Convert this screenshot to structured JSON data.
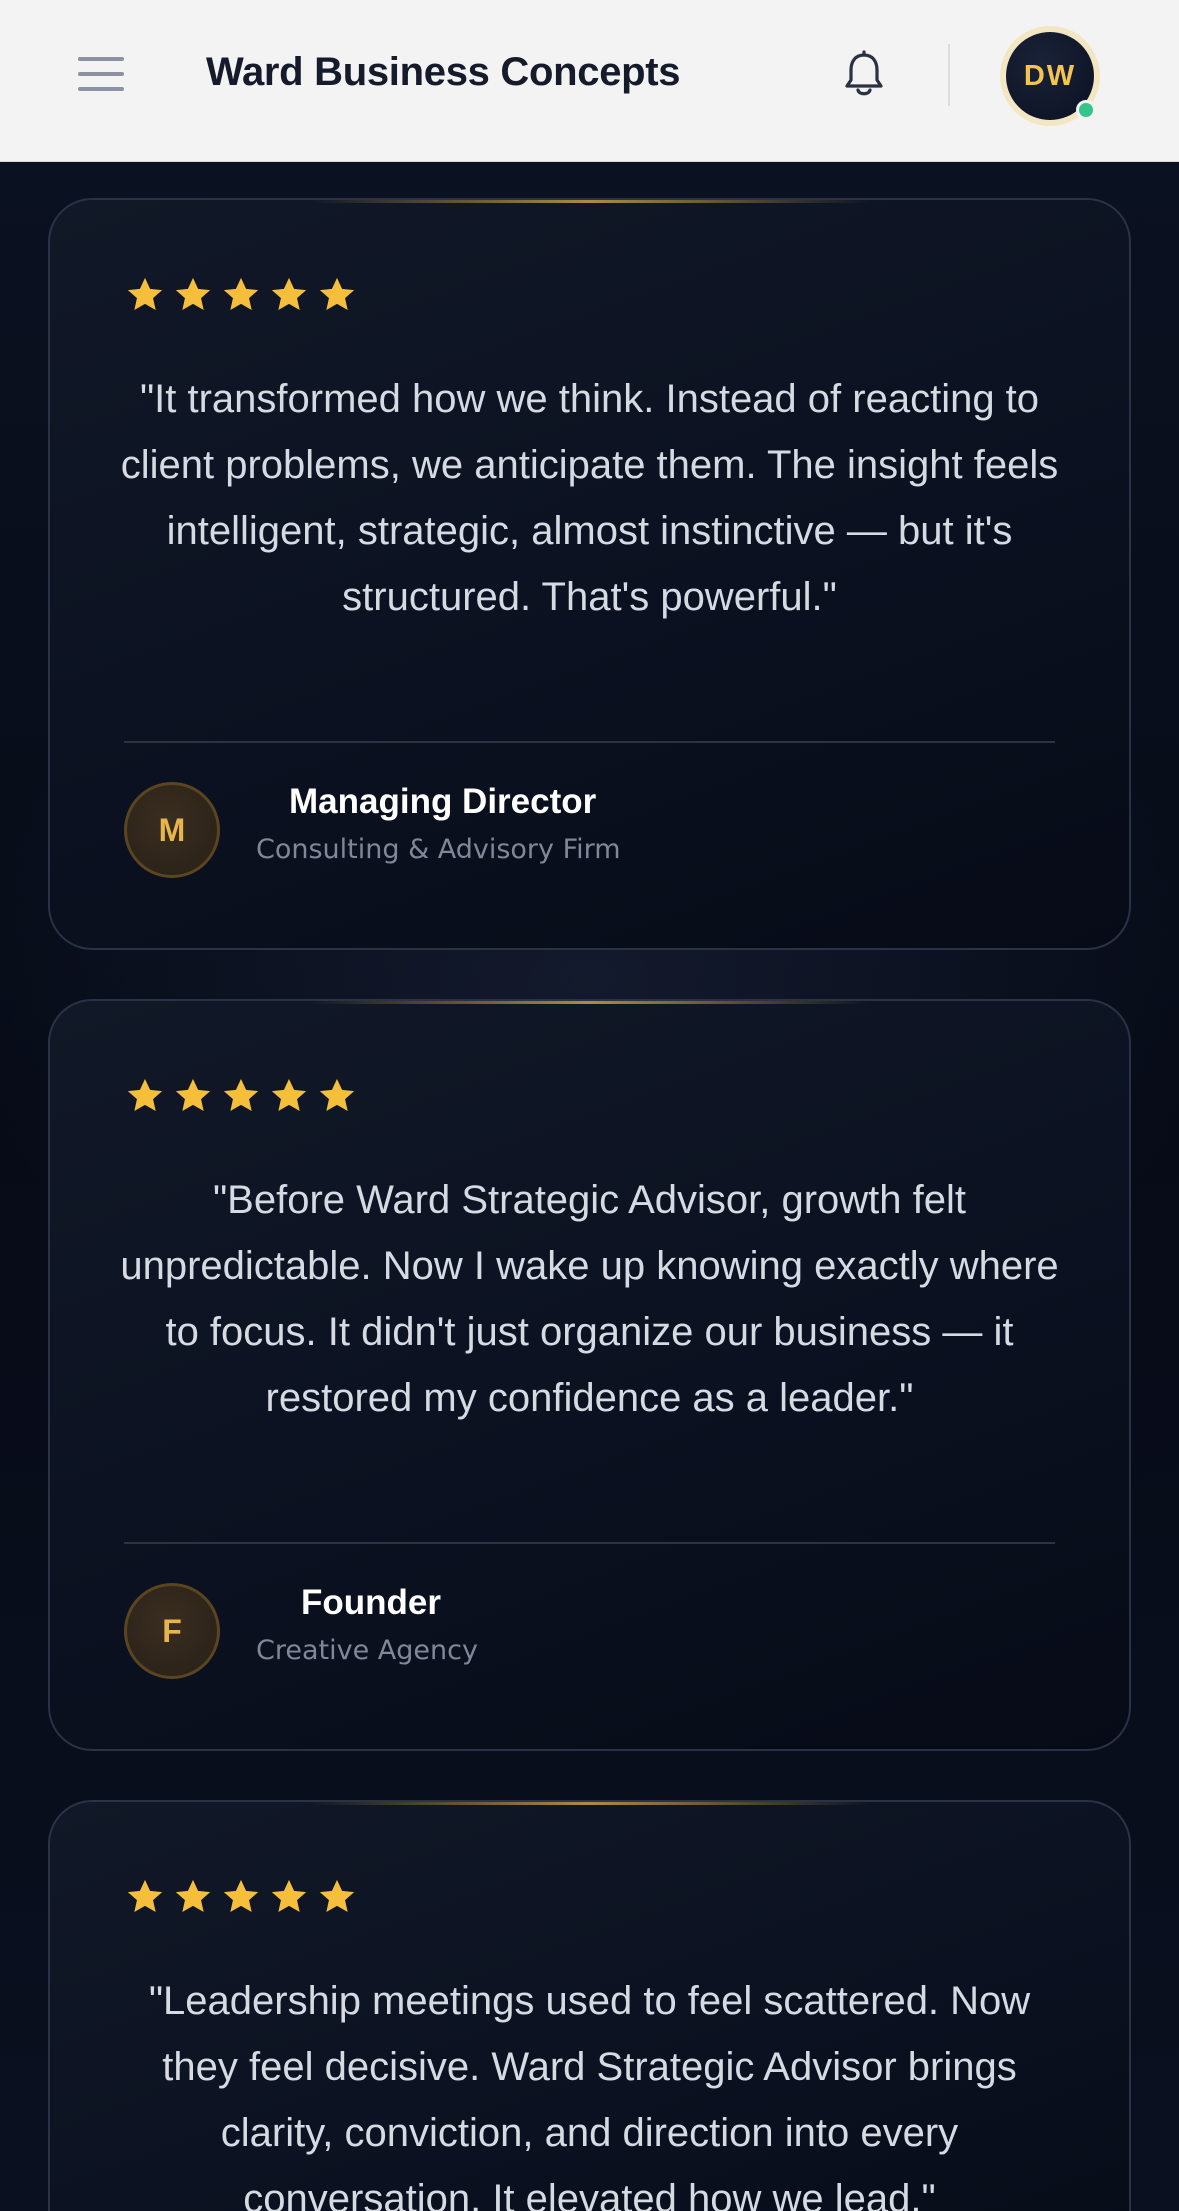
{
  "header": {
    "menu_icon": "hamburger-menu-icon",
    "title": "Ward Business Concepts",
    "bell_icon": "bell-icon",
    "avatar_initials": "DW",
    "status": "online"
  },
  "colors": {
    "star": "#f5be3c",
    "accent_gold": "#e7b54a",
    "header_bg": "#f3f3f3",
    "page_bg": "#080d1c",
    "online": "#35c58a"
  },
  "testimonials": [
    {
      "rating": 5,
      "quote": "\"It transformed how we think. Instead of reacting to client problems, we anticipate them. The insight feels intelligent, strategic, almost instinctive — but it's structured. That's powerful.\"",
      "initial": "M",
      "role": "Managing Director",
      "organization": "Consulting & Advisory Firm"
    },
    {
      "rating": 5,
      "quote": "\"Before Ward Strategic Advisor, growth felt unpredictable. Now I wake up knowing exactly where to focus. It didn't just organize our business — it restored my confidence as a leader.\"",
      "initial": "F",
      "role": "Founder",
      "organization": "Creative Agency"
    },
    {
      "rating": 5,
      "quote": "\"Leadership meetings used to feel scattered. Now they feel decisive. Ward Strategic Advisor brings clarity, conviction, and direction into every conversation. It elevated how we lead.\""
    }
  ]
}
